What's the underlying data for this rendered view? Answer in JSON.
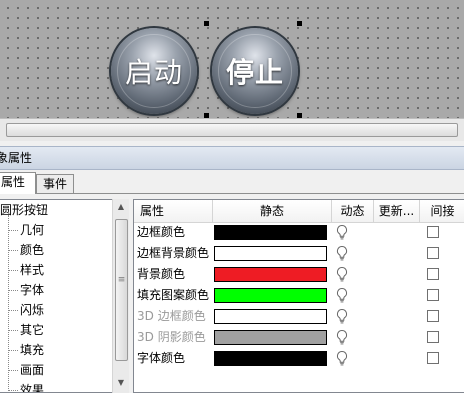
{
  "canvas": {
    "buttons": [
      {
        "label": "启动",
        "bold": false
      },
      {
        "label": "停止",
        "bold": true
      }
    ]
  },
  "panel": {
    "title": "象属性",
    "tabs": [
      {
        "label": "属性",
        "active": true
      },
      {
        "label": "事件",
        "active": false
      }
    ]
  },
  "tree": {
    "root": "圆形按钮",
    "children": [
      "几何",
      "颜色",
      "样式",
      "字体",
      "闪烁",
      "其它",
      "填充",
      "画面",
      "效果"
    ],
    "selected": "颜色"
  },
  "grid": {
    "columns": [
      "属性",
      "静态",
      "动态",
      "更新...",
      "间接"
    ],
    "rows": [
      {
        "name": "边框颜色",
        "color": "#000000",
        "disabled": false
      },
      {
        "name": "边框背景颜色",
        "color": "#ffffff",
        "disabled": false
      },
      {
        "name": "背景颜色",
        "color": "#ee1c24",
        "disabled": false
      },
      {
        "name": "填充图案颜色",
        "color": "#00ff00",
        "disabled": false
      },
      {
        "name": "3D 边框颜色",
        "color": "#ffffff",
        "disabled": true
      },
      {
        "name": "3D 阴影颜色",
        "color": "#a0a0a0",
        "disabled": true
      },
      {
        "name": "字体颜色",
        "color": "#000000",
        "disabled": false
      }
    ]
  }
}
